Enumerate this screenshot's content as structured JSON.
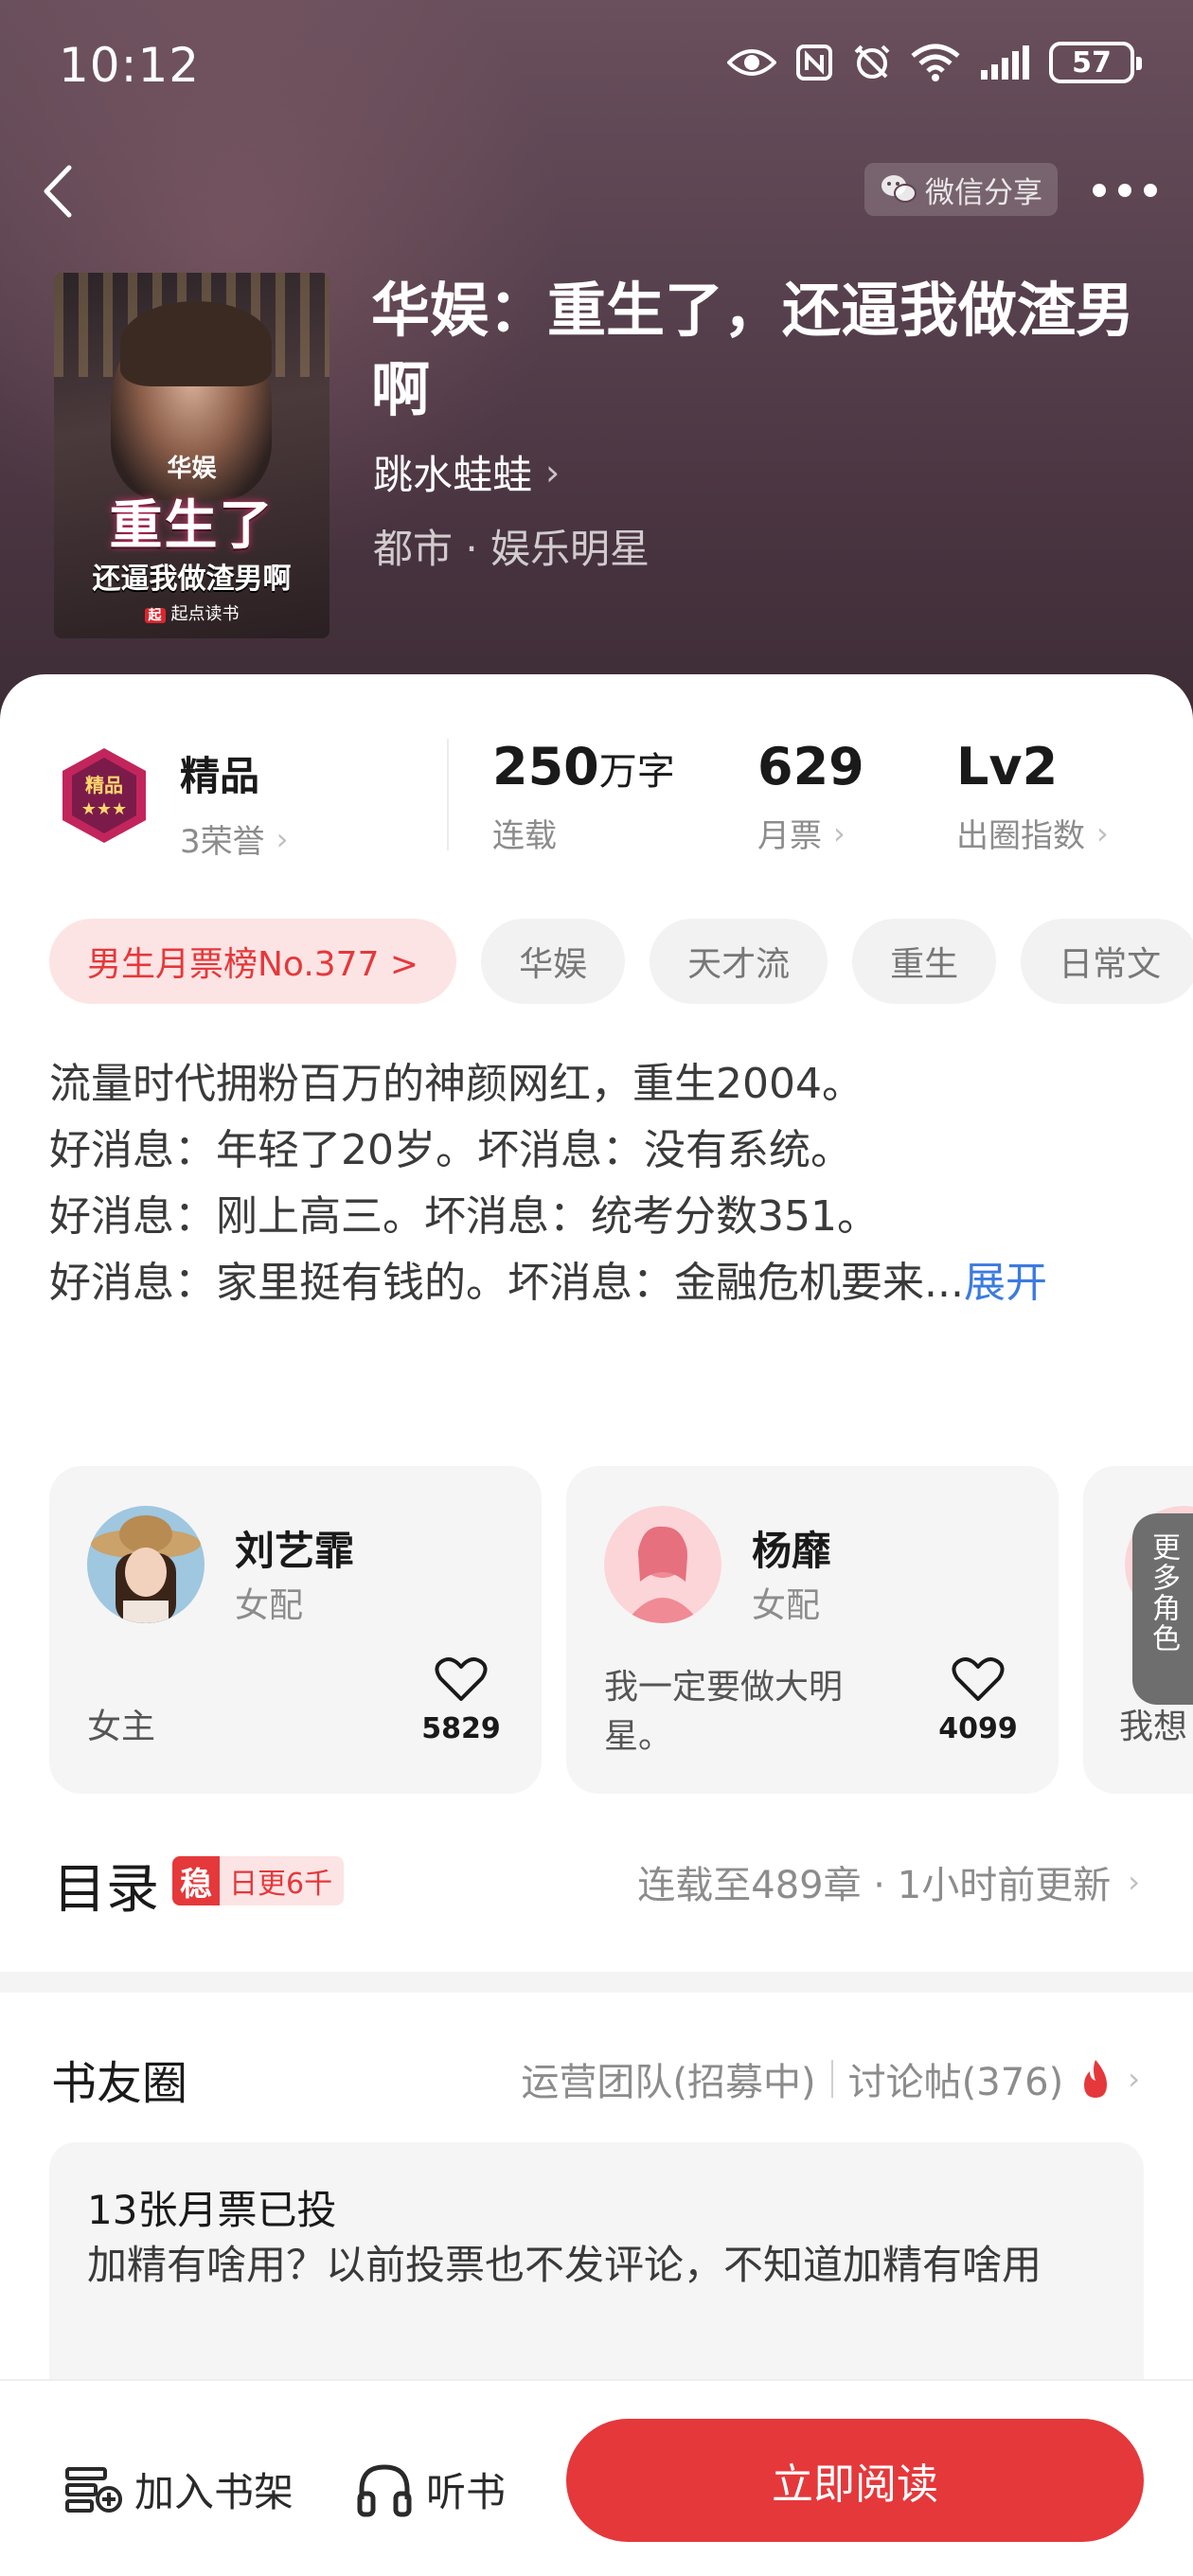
{
  "status_bar": {
    "time": "10:12",
    "battery": "57"
  },
  "header": {
    "share_label": "微信分享"
  },
  "book": {
    "title": "华娱：重生了，还逼我做渣男啊",
    "author": "跳水蛙蛙",
    "genre": "都市 · 娱乐明星",
    "cover": {
      "line1": "华娱",
      "line2": "重生了",
      "line3": "还逼我做渣男啊",
      "publisher": "起点读书"
    }
  },
  "stats": {
    "quality": {
      "label": "精品",
      "sub": "3荣誉"
    },
    "words": {
      "value": "250",
      "unit": "万字",
      "sub": "连载"
    },
    "tickets": {
      "value": "629",
      "sub": "月票"
    },
    "index": {
      "value": "Lv2",
      "sub": "出圈指数"
    }
  },
  "tags": [
    {
      "label": "男生月票榜No.377 >"
    },
    {
      "label": "华娱"
    },
    {
      "label": "天才流"
    },
    {
      "label": "重生"
    },
    {
      "label": "日常文"
    }
  ],
  "intro": {
    "lines": [
      "流量时代拥粉百万的神颜网红，重生2004。",
      "好消息：年轻了20岁。坏消息：没有系统。",
      "好消息：刚上高三。坏消息：统考分数351。",
      "好消息：家里挺有钱的。坏消息：金融危机要来..."
    ],
    "expand_label": "展开"
  },
  "characters": [
    {
      "name": "刘艺霏",
      "role": "女配",
      "desc": "女主",
      "likes": "5829"
    },
    {
      "name": "杨靡",
      "role": "女配",
      "desc": "我一定要做大明星。",
      "likes": "4099"
    },
    {
      "name": "",
      "role": "",
      "desc": "我想",
      "likes": ""
    }
  ],
  "more_roles_label": "更多角色",
  "catalog": {
    "title": "目录",
    "badge_char": "稳",
    "badge_text": "日更6千",
    "status": "连载至489章 · 1小时前更新"
  },
  "circle": {
    "title": "书友圈",
    "link1": "运营团队(招募中)",
    "link2": "讨论帖(376)",
    "post_head": "13张月票已投",
    "post_body": "加精有啥用？以前投票也不发评论，不知道加精有啥用"
  },
  "bottom": {
    "add_shelf": "加入书架",
    "listen": "听书",
    "read_now": "立即阅读"
  },
  "colors": {
    "accent": "#e5383b",
    "link": "#3b7be0"
  }
}
